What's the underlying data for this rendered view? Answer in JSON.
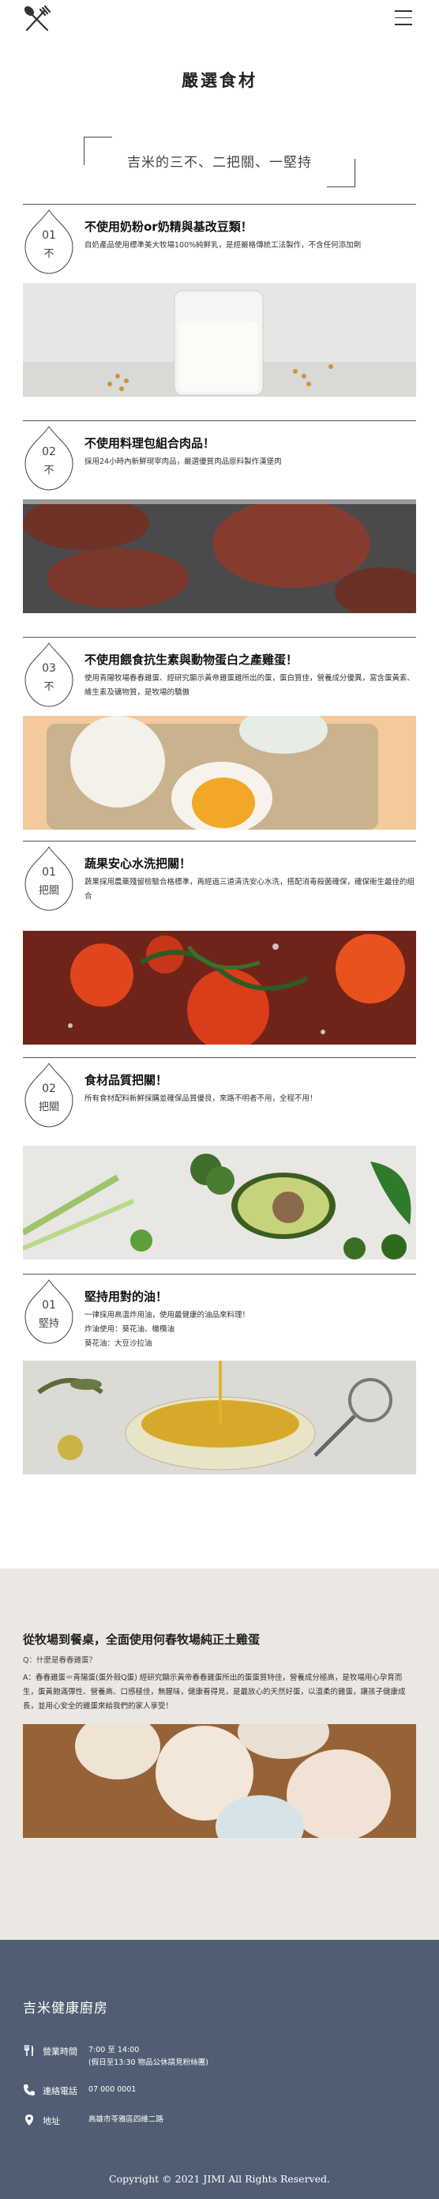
{
  "header": {
    "logo_icon": "fork-spoon-icon",
    "menu_icon": "hamburger-icon"
  },
  "page_title": "嚴選食材",
  "quote": "吉米的三不、二把關、一堅持",
  "items": [
    {
      "num": "01",
      "sub": "不",
      "title": "不使用奶粉or奶精與基改豆類！",
      "desc": "自奶產品使用標準美大牧場100%純鮮乳，是經嚴格傳統工法製作，不含任何添加劑",
      "image": "milk-glass-photo"
    },
    {
      "num": "02",
      "sub": "不",
      "title": "不使用料理包組合肉品！",
      "desc": "採用24小時內新鮮現宰肉品，嚴選優質肉品原料製作漢堡肉",
      "image": "hamburger-patties-photo"
    },
    {
      "num": "03",
      "sub": "不",
      "title": "不使用餵食抗生素與動物蛋白之產雞蛋！",
      "desc": "使用青陽牧場春春雞蛋、經研究顯示黃帝雞蛋雞所出的蛋，蛋白質佳，營養成分優異，富含蛋黃素、維生素及礦物質，是牧場的驕傲",
      "image": "eggs-in-carton-photo"
    },
    {
      "num": "01",
      "sub": "把關",
      "title": "蔬果安心水洗把關！",
      "desc": "蔬果採用農藥殘留檢驗合格標準，再經過三道清洗安心水洗，搭配消毒殺菌確保，確保衛生最佳的組合",
      "image": "tomatoes-in-water-photo"
    },
    {
      "num": "02",
      "sub": "把關",
      "title": "食材品質把關！",
      "desc": "所有食材配料新鮮採購並確保品質優良，來路不明者不用，全程不用！",
      "image": "vegetables-avocado-photo"
    },
    {
      "num": "01",
      "sub": "堅持",
      "title": "堅持用對的油！",
      "desc_lines": [
        "一律採用高溫炸用油，使用最健康的油品來料理！",
        "炸油使用：葵花油、橄欖油",
        "葵花油：大豆沙拉油"
      ],
      "image": "oil-bowl-photo"
    }
  ],
  "egg_section": {
    "title": "從牧場到餐桌，全面使用何春牧場純正土雞蛋",
    "question": "Q：什麼是春春雞蛋？",
    "answer": "A：春春雞蛋＝青陽蛋(蛋外殼Q蛋) 經研究顯示黃帝春春雞蛋所出的蛋蛋質特佳，營養成分極高，是牧場用心孕育而生，蛋黃飽滿彈性、營養高、口感極佳，無腥味，健康看得見，是最放心的天然好蛋，以溫柔的雞蛋，讓孩子健康成長，並用心安全的雞蛋來給我們的家人享受！",
    "image": "brown-eggs-photo"
  },
  "footer": {
    "brand": "吉米健康廚房",
    "hours_label": "營業時間",
    "hours_value": "7:00 至 14:00",
    "hours_note": "(假日至13:30 物品公休請見粉絲團)",
    "phone_label": "連絡電話",
    "phone_value": "07 000 0001",
    "address_label": "地址",
    "address_value": "高雄市苓雅區四維二路",
    "copyright": "Copyright © 2021 JIMI All Rights Reserved."
  },
  "colors": {
    "footer_bg": "#4f5e72",
    "egg_section_bg": "#ebe7e2",
    "rule": "#555555"
  }
}
